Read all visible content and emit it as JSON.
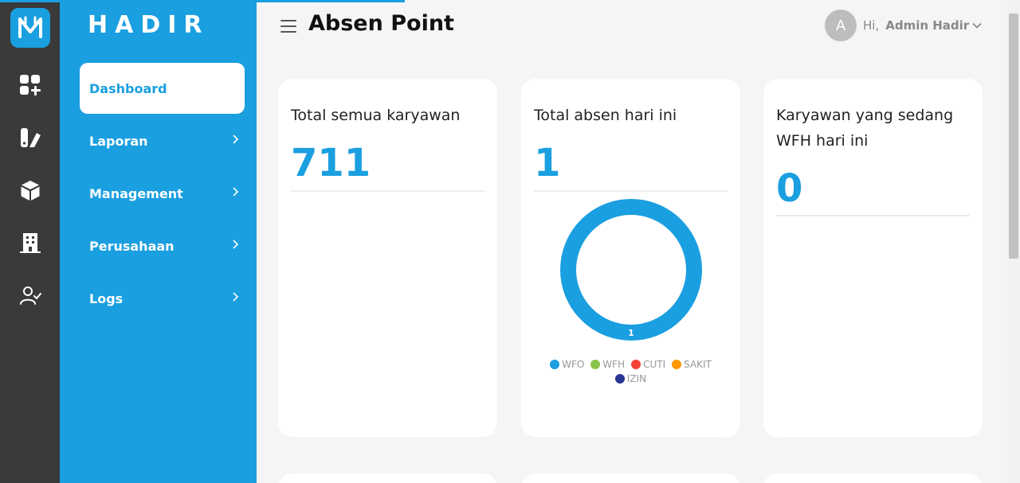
{
  "brand": {
    "name": "HADIR"
  },
  "rail": {
    "icons": [
      "hadir-logo-icon",
      "dashboard-add-icon",
      "report-icon",
      "box-icon",
      "building-icon",
      "user-check-icon"
    ]
  },
  "sidebar": {
    "items": [
      {
        "label": "Dashboard",
        "active": true
      },
      {
        "label": "Laporan"
      },
      {
        "label": "Management"
      },
      {
        "label": "Perusahaan"
      },
      {
        "label": "Logs"
      }
    ]
  },
  "header": {
    "title": "Absen Point",
    "greeting": "Hi,",
    "username": "Admin Hadir",
    "avatar_initial": "A"
  },
  "cards": [
    {
      "title": "Total semua karyawan",
      "value": "711"
    },
    {
      "title": "Total absen hari ini",
      "value": "1"
    },
    {
      "title": "Karyawan yang sedang WFH hari ini",
      "value": "0"
    }
  ],
  "chart_data": {
    "type": "pie",
    "categories": [
      "WFO",
      "WFH",
      "CUTI",
      "SAKIT",
      "IZIN"
    ],
    "values": [
      1,
      0,
      0,
      0,
      0
    ],
    "colors": [
      "#1a9fe0",
      "#8bc34a",
      "#f44336",
      "#ff9800",
      "#283593"
    ],
    "data_labels": [
      "1"
    ],
    "legend": "bottom"
  },
  "colors": {
    "accent": "#1a9fe0",
    "rail": "#3a3a3a"
  }
}
